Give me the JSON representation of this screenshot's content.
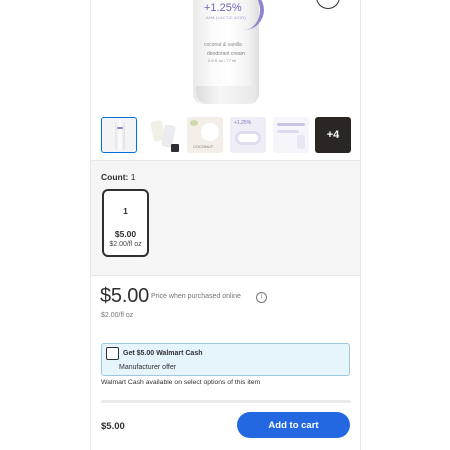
{
  "product_image": {
    "percent": "+1.25%",
    "subline": "AHA (LACTIC ACID)",
    "scent": "coconut & vanilla",
    "type": "deodorant cream",
    "size": "2.6 fl. oz / 77 ml"
  },
  "thumbnails": {
    "more_label": "+4",
    "thumb4_percent": "+1.25%",
    "thumb3_text": "COCONUT"
  },
  "count": {
    "label": "Count:",
    "value": "1",
    "options": [
      {
        "qty": "1",
        "price": "$5.00",
        "unit_price": "$2.00/fl oz"
      }
    ]
  },
  "price": {
    "main": "$5.00",
    "note": "Price when purchased online",
    "unit": "$2.00/fl oz"
  },
  "offer": {
    "title": "Get $5.00 Walmart Cash",
    "subtitle": "Manufacturer offer",
    "note": "Walmart Cash available on select options of this item"
  },
  "bottom": {
    "price": "$5.00",
    "add_to_cart": "Add to cart"
  },
  "colors": {
    "primary_blue": "#2468e1",
    "offer_bg": "#e6f4fb",
    "text": "#2e2f32"
  },
  "icons": [
    "zoom-icon",
    "info-icon",
    "checkbox-icon"
  ]
}
